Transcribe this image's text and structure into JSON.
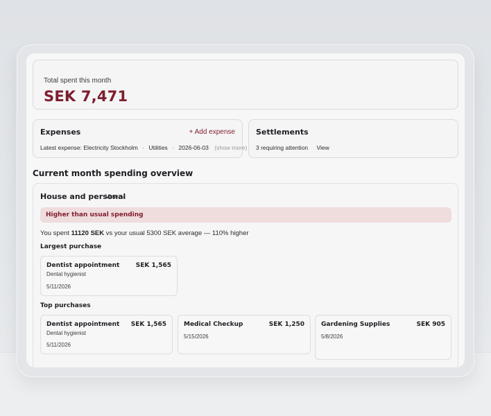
{
  "total": {
    "label": "Total spent this month",
    "value": "SEK 7,471"
  },
  "expenses": {
    "title": "Expenses",
    "add_label": "+ Add expense",
    "latest_prefix": "Latest expense:",
    "latest_name": "Electricity Stockholm",
    "latest_category": "Utilities",
    "latest_date": "2026-06-03",
    "show_more": "(show more)"
  },
  "settlements": {
    "title": "Settlements",
    "status": "3 requiring attention",
    "view_label": "View"
  },
  "overview": {
    "heading": "Current month spending overview",
    "group_title": "House and personal",
    "view_label": "View →",
    "alert": "Higher than usual spending",
    "compare": {
      "prefix": "You spent",
      "amount": "11120 SEK",
      "suffix": "vs your usual 5300 SEK average — 110% higher"
    },
    "largest_heading": "Largest purchase",
    "largest": {
      "name": "Dentist appointment",
      "amount": "SEK 1,565",
      "sub": "Dental hygienist",
      "date": "5/11/2026"
    },
    "top_heading": "Top purchases",
    "top": [
      {
        "name": "Dentist appointment",
        "amount": "SEK 1,565",
        "sub": "Dental hygienist",
        "date": "5/11/2026"
      },
      {
        "name": "Medical Checkup",
        "amount": "SEK 1,250",
        "sub": "",
        "date": "5/15/2026"
      },
      {
        "name": "Gardening Supplies",
        "amount": "SEK 905",
        "sub": "",
        "date": "5/8/2026"
      }
    ]
  },
  "colors": {
    "accent": "#7e1d2e",
    "alert_bg": "#efdcdd"
  }
}
